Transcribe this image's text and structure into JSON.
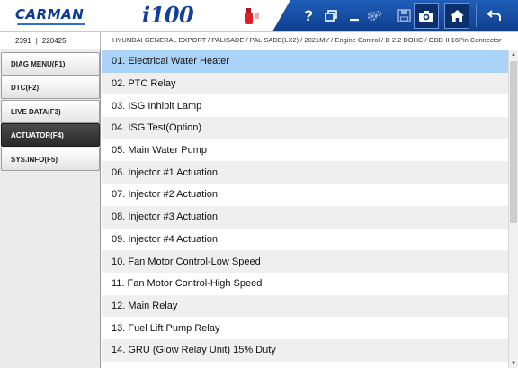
{
  "header": {
    "logo": "CARMAN",
    "model": "i100",
    "toolbar": {
      "help": "?",
      "icons": [
        "help-icon",
        "window-icon",
        "minimize-icon",
        "settings-icon",
        "save-icon",
        "camera-icon",
        "home-icon",
        "back-icon"
      ]
    },
    "colors": {
      "toolbar_bg": "#1a54ad",
      "brand": "#0a3c95",
      "usb": "#e21e26"
    }
  },
  "info": {
    "serial_a": "2391",
    "serial_sep": "|",
    "serial_b": "220425",
    "vehicle_path": "HYUNDAI GENERAL EXPORT / PALISADE / PALISADE(LX2) / 2021MY / Engine Control / D 2.2 DOHC / OBD-II 16Pin Connector"
  },
  "menu": {
    "active_index": 3,
    "items": [
      {
        "label": "DIAG MENU(F1)"
      },
      {
        "label": "DTC(F2)"
      },
      {
        "label": "LIVE DATA(F3)"
      },
      {
        "label": "ACTUATOR(F4)"
      },
      {
        "label": "SYS.INFO(F5)"
      }
    ]
  },
  "actuator_list": {
    "selected_index": 0,
    "items": [
      "01. Electrical Water Heater",
      "02. PTC Relay",
      "03. ISG Inhibit Lamp",
      "04. ISG Test(Option)",
      "05. Main Water Pump",
      "06. Injector #1 Actuation",
      "07. Injector #2 Actuation",
      "08. Injector #3 Actuation",
      "09. Injector #4 Actuation",
      "10. Fan Motor Control-Low Speed",
      "11. Fan Motor Control-High Speed",
      "12. Main Relay",
      "13. Fuel Lift Pump Relay",
      "14. GRU (Glow Relay Unit) 15% Duty"
    ],
    "selected_color": "#aad3f7"
  }
}
